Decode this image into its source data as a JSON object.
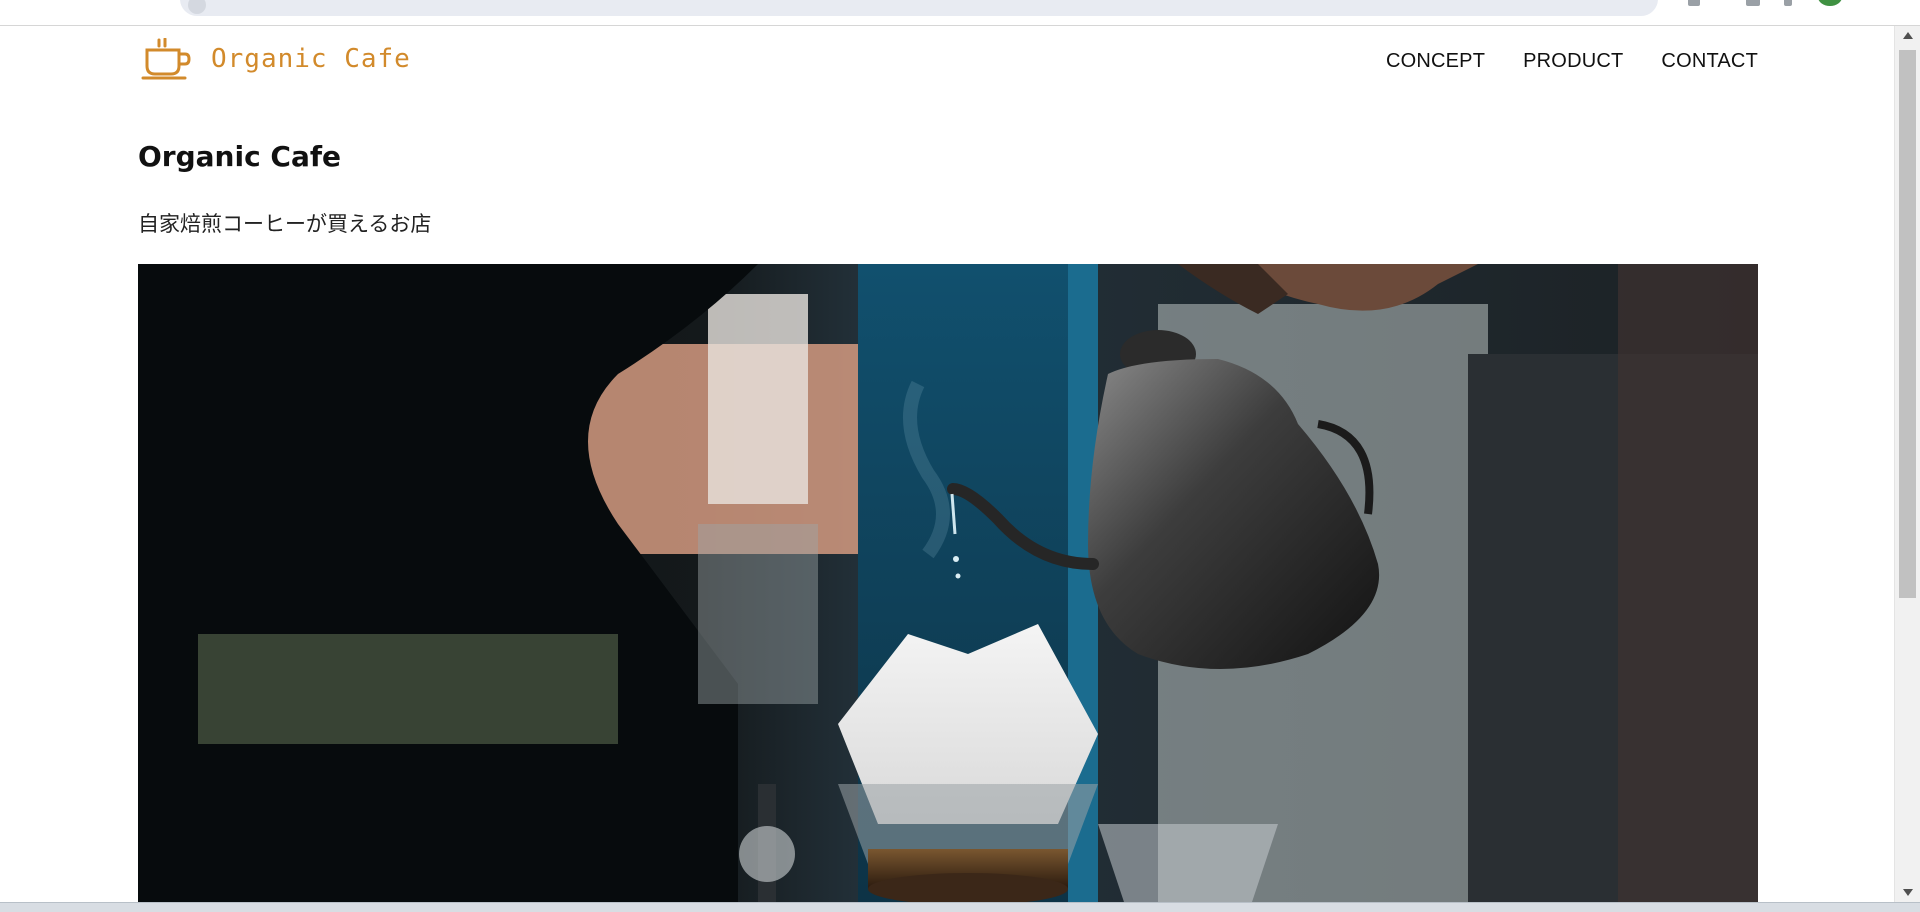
{
  "header": {
    "logo_text": "Organic Cafe",
    "logo_icon": "coffee-cup-icon",
    "brand_color": "#d28a2b"
  },
  "nav": {
    "items": [
      "CONCEPT",
      "PRODUCT",
      "CONTACT"
    ]
  },
  "hero": {
    "title": "Organic Cafe",
    "subtitle": "自家焙煎コーヒーが買えるお店"
  },
  "colors": {
    "text": "#111111",
    "background": "#ffffff",
    "scrollbar_thumb": "#c1c1c1"
  }
}
